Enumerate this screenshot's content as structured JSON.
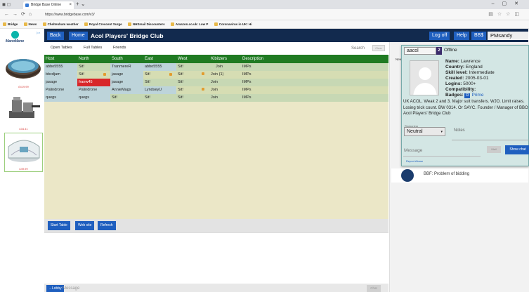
{
  "browser": {
    "tab_title": "Bridge Base Online",
    "tab_close": "×",
    "new_tab": "+ ⌄",
    "url": "https://www.bridgebase.com/v3/",
    "bookmarks": [
      "Bridge",
      "News",
      "Cheltenham weather",
      "Royal Crescent Surge",
      "NHSmail Discounters",
      "Amazon.co.uk: Low P",
      "Coronavirus in UK: Hi"
    ]
  },
  "ads": {
    "brand": "ManoMano",
    "prices": [
      "£419.99",
      "£34.41",
      "£49.99"
    ]
  },
  "header": {
    "back": "Back",
    "home": "Home",
    "club_title": "Acol Players' Bridge Club",
    "logoff": "Log off",
    "help": "Help",
    "bbs": "BB$",
    "username": "PMsandy"
  },
  "subtabs": {
    "open_tables": "Open Tables",
    "full_tables": "Full Tables",
    "friends": "Friends",
    "search": "Search",
    "clear": "Clear"
  },
  "table": {
    "columns": [
      "Host",
      "North",
      "South",
      "East",
      "West",
      "Kibitzers",
      "Description"
    ],
    "rows": [
      {
        "host": "abbo5555",
        "north": "Sit!",
        "south": "TranmereR",
        "east": "abbo5555",
        "west": "Sit!",
        "kibitzers": "Join",
        "desc": "IMPs"
      },
      {
        "host": "bbcdjam",
        "north": "Sit!",
        "south": "jasage",
        "east": "Sit!",
        "west": "Sit!",
        "kibitzers": "Join (1)",
        "desc": "IMPs"
      },
      {
        "host": "jasage",
        "north": "franw45",
        "south": "jasage",
        "east": "Sit!",
        "west": "Sit!",
        "kibitzers": "Join",
        "desc": "IMPs"
      },
      {
        "host": "Palindrone",
        "north": "Palindrone",
        "south": "AnnieMags",
        "east": "LyndseyU",
        "west": "Sit!",
        "kibitzers": "Join",
        "desc": "IMPs"
      },
      {
        "host": "quegs",
        "north": "quegs",
        "south": "Sit!",
        "east": "Sit!",
        "west": "Sit!",
        "kibitzers": "Join",
        "desc": "IMPs"
      }
    ]
  },
  "buttons": {
    "start_table": "Start Table",
    "web_site": "Web site",
    "refresh": "Refresh",
    "lobby": "→Lobby",
    "message_placeholder": "Message",
    "chat": "Chat"
  },
  "right_panel": {
    "tab": "New",
    "item_text": "BBF: Problem of bidding"
  },
  "profile": {
    "username": "aacol",
    "flag": "2",
    "status": "Offline",
    "name_label": "Name:",
    "name": "Lawrence",
    "country_label": "Country:",
    "country": "England",
    "skill_label": "Skill level:",
    "skill": "Intermediate",
    "created_label": "Created:",
    "created": "2005-03-01",
    "logins_label": "Logins:",
    "logins": "5000+",
    "compat_label": "Compatibility:",
    "badges_label": "Badges:",
    "badge_letter": "R",
    "badge": "Prime",
    "description": "UK ACOL. Weak 2 and 3. Major suit transfers. WJO. Limit raises. Losing trick count. BW 0314. Or SAYC. Founder / Manager of BBO Acol Players' Bridge Club",
    "reckoning_label": "Reckoning",
    "reckoning_value": "Neutral",
    "notes_label": "Notes",
    "message_placeholder": "Message",
    "mail_btn": "Mail",
    "show_chat": "Show chat",
    "report_abuse": "Report Abuse"
  }
}
